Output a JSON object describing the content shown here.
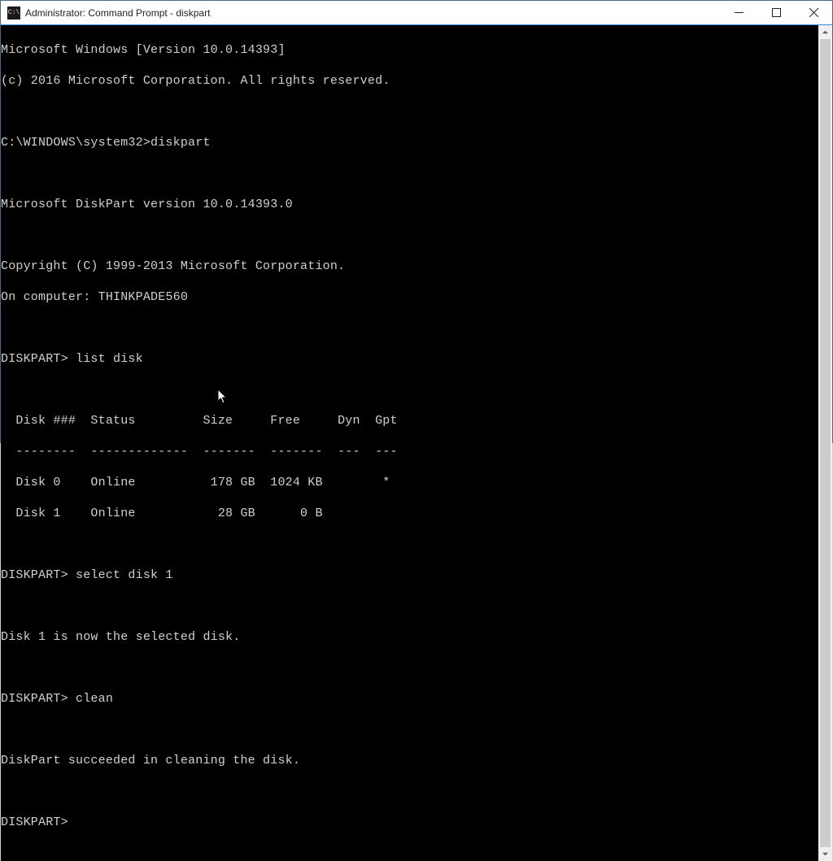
{
  "titlebar": {
    "icon_text": "C:\\",
    "title": "Administrator: Command Prompt - diskpart"
  },
  "winbtn": {
    "minimize_label": "Minimize",
    "maximize_label": "Maximize",
    "close_label": "Close"
  },
  "terminal": {
    "l0": "Microsoft Windows [Version 10.0.14393]",
    "l1": "(c) 2016 Microsoft Corporation. All rights reserved.",
    "l2": "",
    "l3": "C:\\WINDOWS\\system32>diskpart",
    "l4": "",
    "l5": "Microsoft DiskPart version 10.0.14393.0",
    "l6": "",
    "l7": "Copyright (C) 1999-2013 Microsoft Corporation.",
    "l8": "On computer: THINKPADE560",
    "l9": "",
    "l10": "DISKPART> list disk",
    "l11": "",
    "l12": "  Disk ###  Status         Size     Free     Dyn  Gpt",
    "l13": "  --------  -------------  -------  -------  ---  ---",
    "l14": "  Disk 0    Online          178 GB  1024 KB        *",
    "l15": "  Disk 1    Online           28 GB      0 B",
    "l16": "",
    "l17": "DISKPART> select disk 1",
    "l18": "",
    "l19": "Disk 1 is now the selected disk.",
    "l20": "",
    "l21": "DISKPART> clean",
    "l22": "",
    "l23": "DiskPart succeeded in cleaning the disk.",
    "l24": "",
    "l25": "DISKPART> "
  },
  "disk_table": {
    "columns": [
      "Disk ###",
      "Status",
      "Size",
      "Free",
      "Dyn",
      "Gpt"
    ],
    "rows": [
      {
        "id": "Disk 0",
        "status": "Online",
        "size": "178 GB",
        "free": "1024 KB",
        "dyn": "",
        "gpt": "*"
      },
      {
        "id": "Disk 1",
        "status": "Online",
        "size": "28 GB",
        "free": "0 B",
        "dyn": "",
        "gpt": ""
      }
    ]
  },
  "commands": {
    "initial_prompt": "C:\\WINDOWS\\system32>",
    "diskpart_invocation": "diskpart",
    "diskpart_prompt": "DISKPART>",
    "cmd_list_disk": "list disk",
    "cmd_select_disk": "select disk 1",
    "cmd_clean": "clean",
    "msg_selected": "Disk 1 is now the selected disk.",
    "msg_clean_ok": "DiskPart succeeded in cleaning the disk."
  }
}
